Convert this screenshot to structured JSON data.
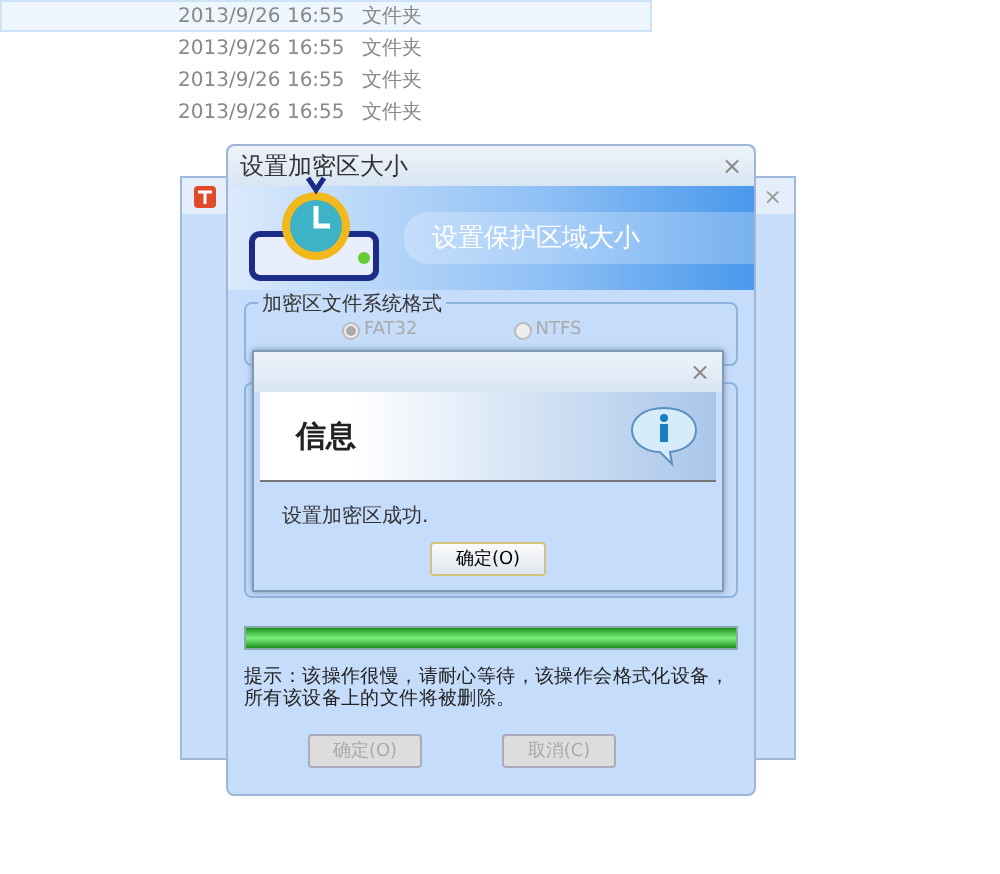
{
  "file_list": [
    {
      "date": "2013/9/26 16:55",
      "type": "文件夹",
      "selected": true
    },
    {
      "date": "2013/9/26 16:55",
      "type": "文件夹",
      "selected": false
    },
    {
      "date": "2013/9/26 16:55",
      "type": "文件夹",
      "selected": false
    },
    {
      "date": "2013/9/26 16:55",
      "type": "文件夹",
      "selected": false
    }
  ],
  "back_window": {
    "close": "×"
  },
  "dialog": {
    "title": "设置加密区大小",
    "close": "×",
    "banner": "设置保护区域大小",
    "group_title": "加密区文件系统格式",
    "radios": [
      {
        "label": "FAT32",
        "selected": true
      },
      {
        "label": "NTFS",
        "selected": false
      }
    ],
    "progress": {
      "level": 1
    },
    "hint": "提示：该操作很慢，请耐心等待，该操作会格式化设备，所有该设备上的文件将被删除。",
    "buttons": [
      {
        "label": "确定(O)",
        "disabled": true
      },
      {
        "label": "取消(C)",
        "disabled": true
      }
    ]
  },
  "message": {
    "close": "×",
    "heading": "信息",
    "text": "设置加密区成功.",
    "button": "确定(O)"
  }
}
